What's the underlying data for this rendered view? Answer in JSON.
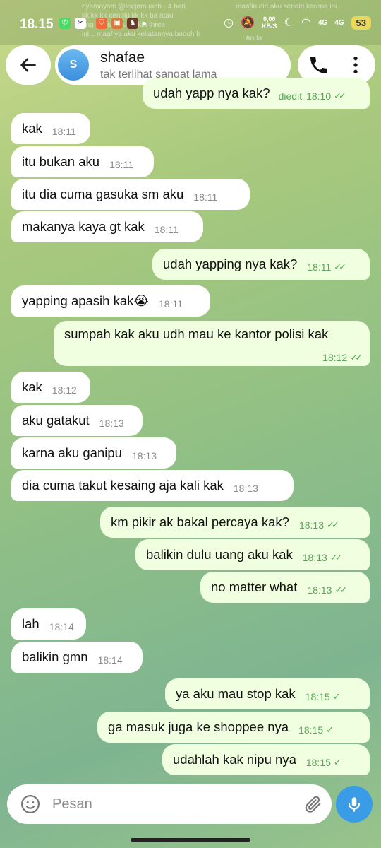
{
  "status_bar": {
    "time": "18.15",
    "speed_top": "0,00",
    "speed_bottom": "KB/S",
    "net1": "4G",
    "net2": "4G",
    "battery": "53"
  },
  "notification_peek": {
    "line1": "nyamnyom @leejnmuach · 4 hari",
    "line2": "kk kk kk cenblu kk kk ba atau",
    "line3": "ang bantu aku naikin threa",
    "line4": "ini... maaf ya aku keliatannya bodoh b",
    "right1": "maafin diri aku sendiri karena ini..",
    "right2": "Anda"
  },
  "header": {
    "avatar_letter": "S",
    "name": "shafae",
    "status": "tak terlihat sangat lama"
  },
  "messages": [
    {
      "dir": "out",
      "text": "udah yapp nya kak?",
      "time": "18:10",
      "edited": "diedit",
      "ticks": "✓✓"
    },
    {
      "dir": "in",
      "text": "kak",
      "time": "18:11"
    },
    {
      "dir": "in",
      "text": "itu bukan aku",
      "time": "18:11"
    },
    {
      "dir": "in",
      "text": "itu dia cuma gasuka sm aku",
      "time": "18:11"
    },
    {
      "dir": "in",
      "text": "makanya kaya gt kak",
      "time": "18:11"
    },
    {
      "dir": "out",
      "text": "udah yapping nya kak?",
      "time": "18:11",
      "ticks": "✓✓"
    },
    {
      "dir": "in",
      "text": "yapping apasih kak😭",
      "time": "18:11"
    },
    {
      "dir": "out",
      "text": "sumpah kak aku udh mau ke kantor polisi kak",
      "time": "18:12",
      "ticks": "✓✓"
    },
    {
      "dir": "in",
      "text": "kak",
      "time": "18:12"
    },
    {
      "dir": "in",
      "text": "aku gatakut",
      "time": "18:13"
    },
    {
      "dir": "in",
      "text": "karna aku ganipu",
      "time": "18:13"
    },
    {
      "dir": "in",
      "text": "dia cuma takut kesaing aja kali kak",
      "time": "18:13"
    },
    {
      "dir": "out",
      "text": "km pikir ak bakal percaya kak?",
      "time": "18:13",
      "ticks": "✓✓"
    },
    {
      "dir": "out",
      "text": "balikin dulu uang aku kak",
      "time": "18:13",
      "ticks": "✓✓"
    },
    {
      "dir": "out",
      "text": "no matter what",
      "time": "18:13",
      "ticks": "✓✓"
    },
    {
      "dir": "in",
      "text": "lah",
      "time": "18:14"
    },
    {
      "dir": "in",
      "text": "balikin gmn",
      "time": "18:14"
    },
    {
      "dir": "out",
      "text": "ya aku mau stop kak",
      "time": "18:15",
      "ticks": "✓"
    },
    {
      "dir": "out",
      "text": "ga masuk juga ke shoppee nya",
      "time": "18:15",
      "ticks": "✓"
    },
    {
      "dir": "out",
      "text": "udahlah kak nipu nya",
      "time": "18:15",
      "ticks": "✓"
    }
  ],
  "input": {
    "placeholder": "Pesan"
  },
  "icons": {
    "back": "arrow-left-icon",
    "call": "phone-icon",
    "more": "more-vertical-icon",
    "emoji": "smile-icon",
    "attach": "paperclip-icon",
    "mic": "microphone-icon"
  },
  "colors": {
    "incoming_bubble": "#ffffff",
    "outgoing_bubble": "#efffdf",
    "tick_green": "#4fae4e",
    "mic_blue": "#3a9be6"
  }
}
